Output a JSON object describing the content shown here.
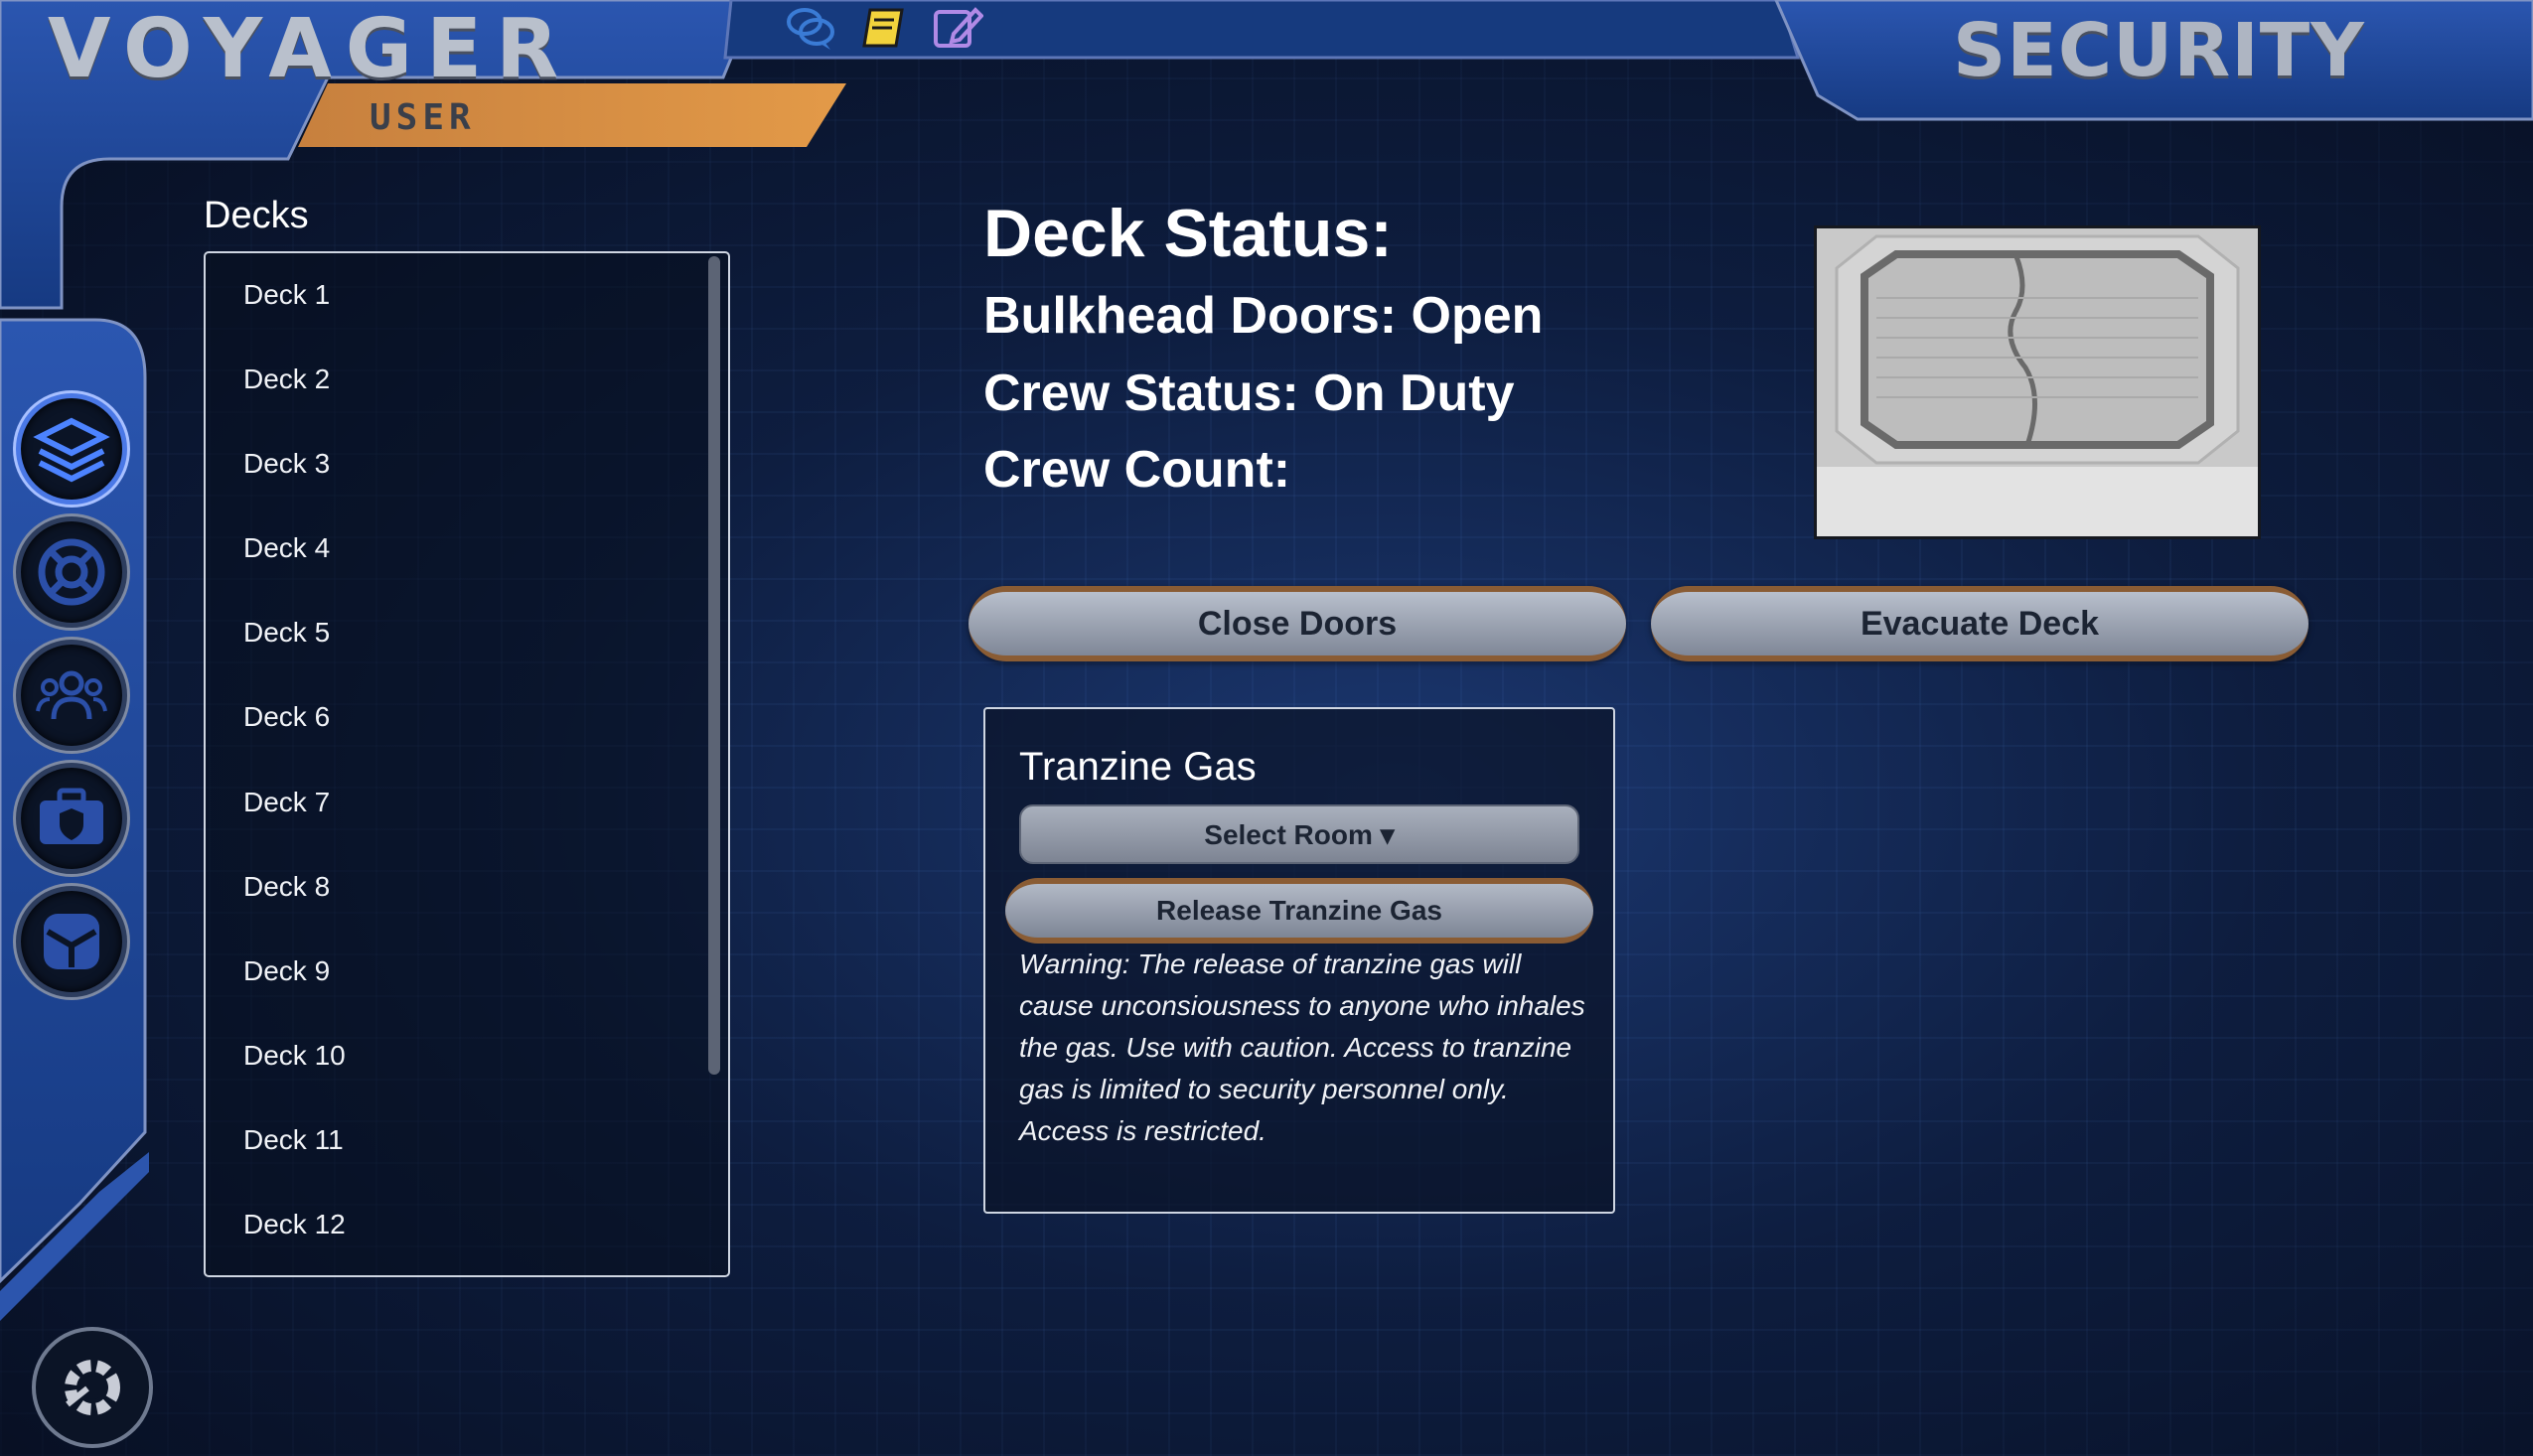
{
  "header": {
    "app_title": "VOYAGER",
    "user_label": "USER",
    "station_title": "SECURITY",
    "top_icons": [
      {
        "name": "chat-icon",
        "color": "#3a7bd5"
      },
      {
        "name": "notebook-icon",
        "color": "#f2d33c"
      },
      {
        "name": "edit-note-icon",
        "color": "#b08ae6"
      }
    ]
  },
  "sidebar_nav": [
    {
      "icon": "layers-icon",
      "active": true
    },
    {
      "icon": "lifebuoy-icon",
      "active": false
    },
    {
      "icon": "crew-icon",
      "active": false
    },
    {
      "icon": "security-kit-icon",
      "active": false
    },
    {
      "icon": "cargo-icon",
      "active": false
    }
  ],
  "settings_icon": "settings-gear-icon",
  "decks": {
    "title": "Decks",
    "items": [
      "Deck 1",
      "Deck 2",
      "Deck 3",
      "Deck 4",
      "Deck 5",
      "Deck 6",
      "Deck 7",
      "Deck 8",
      "Deck 9",
      "Deck 10",
      "Deck 11",
      "Deck 12"
    ]
  },
  "status": {
    "title": "Deck Status:",
    "bulkhead": "Bulkhead Doors: Open",
    "crew_status": "Crew Status: On Duty",
    "crew_count": "Crew Count:"
  },
  "actions": {
    "close_doors": "Close Doors",
    "evacuate": "Evacuate Deck"
  },
  "gas": {
    "title": "Tranzine Gas",
    "select_room": "Select Room ▾",
    "release": "Release Tranzine Gas",
    "warning": "Warning: The release of tranzine gas will cause unconsiousness to anyone who inhales the gas. Use with caution. Access to tranzine gas is limited to security personnel only. Access is restricted."
  },
  "colors": {
    "frame_blue": "#1f4694",
    "accent_orange": "#d98a3a",
    "panel_border": "#cfd6e2"
  }
}
